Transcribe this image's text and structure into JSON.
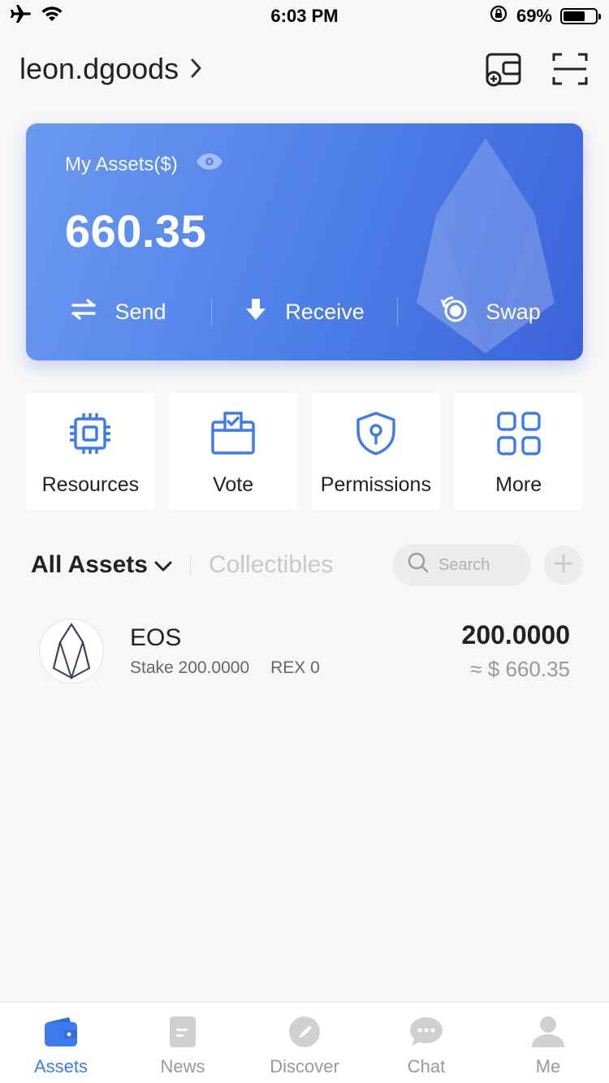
{
  "status_bar": {
    "time": "6:03 PM",
    "battery_text": "69%",
    "battery_level": 0.69
  },
  "header": {
    "account_name": "leon.dgoods",
    "icons": [
      "wallet-add-icon",
      "scan-icon"
    ]
  },
  "asset_card": {
    "label": "My Assets($)",
    "value": "660.35",
    "actions": [
      {
        "label": "Send",
        "icon": "transfer-arrows-icon"
      },
      {
        "label": "Receive",
        "icon": "download-arrow-icon"
      },
      {
        "label": "Swap",
        "icon": "swap-icon"
      }
    ]
  },
  "tiles": [
    {
      "label": "Resources",
      "icon": "cpu-chip-icon"
    },
    {
      "label": "Vote",
      "icon": "ballot-box-icon"
    },
    {
      "label": "Permissions",
      "icon": "shield-key-icon"
    },
    {
      "label": "More",
      "icon": "grid-icon"
    }
  ],
  "tabs": {
    "active": "All Assets",
    "inactive": "Collectibles",
    "search_placeholder": "Search"
  },
  "assets": [
    {
      "name": "EOS",
      "stake": "Stake 200.0000",
      "rex": "REX 0",
      "amount": "200.0000",
      "fiat": "≈ $ 660.35"
    }
  ],
  "bottom_nav": [
    {
      "label": "Assets",
      "icon": "wallet-icon",
      "active": true
    },
    {
      "label": "News",
      "icon": "news-icon",
      "active": false
    },
    {
      "label": "Discover",
      "icon": "compass-icon",
      "active": false
    },
    {
      "label": "Chat",
      "icon": "chat-bubble-icon",
      "active": false
    },
    {
      "label": "Me",
      "icon": "person-icon",
      "active": false
    }
  ],
  "colors": {
    "accent": "#3d7bec",
    "card_start": "#6b9af0",
    "card_end": "#3b63d9",
    "background": "#f7f7f7"
  }
}
